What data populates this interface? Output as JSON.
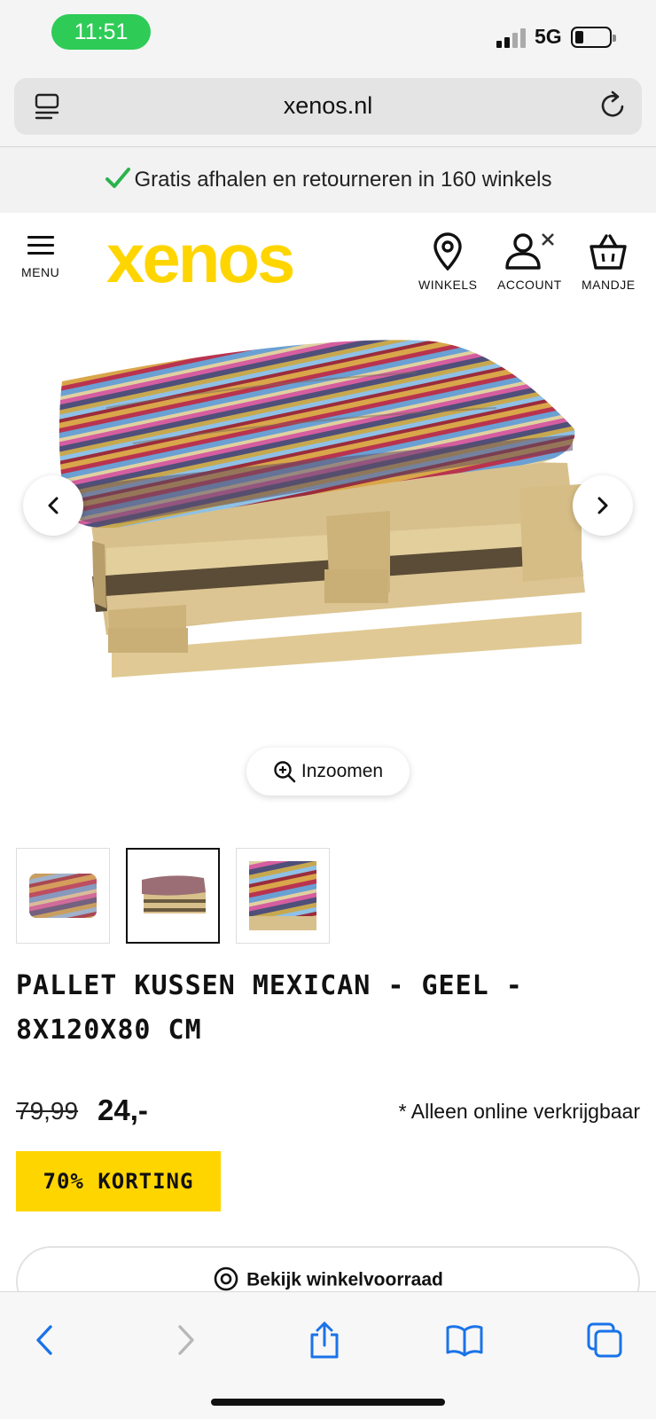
{
  "status_bar": {
    "time": "11:51",
    "network": "5G"
  },
  "browser": {
    "url": "xenos.nl"
  },
  "promo": {
    "text": "Gratis afhalen en retourneren in 160 winkels"
  },
  "header": {
    "menu_label": "MENU",
    "logo_text": "xenos",
    "stores_label": "WINKELS",
    "account_label": "ACCOUNT",
    "cart_label": "MANDJE"
  },
  "gallery": {
    "zoom_label": "Inzoomen",
    "thumbnail_count": 3,
    "active_thumbnail": 2
  },
  "product": {
    "title": "PALLET KUSSEN MEXICAN - GEEL - 8X120X80 CM",
    "old_price": "79,99",
    "new_price": "24,-",
    "availability_note": "* Alleen online verkrijgbaar",
    "discount_badge": "70% KORTING",
    "stock_button": "Bekijk winkelvoorraad"
  },
  "colors": {
    "brand_yellow": "#ffd500",
    "status_green": "#2ecc57",
    "ios_blue": "#1a73e8",
    "check_green": "#2bb24c"
  }
}
